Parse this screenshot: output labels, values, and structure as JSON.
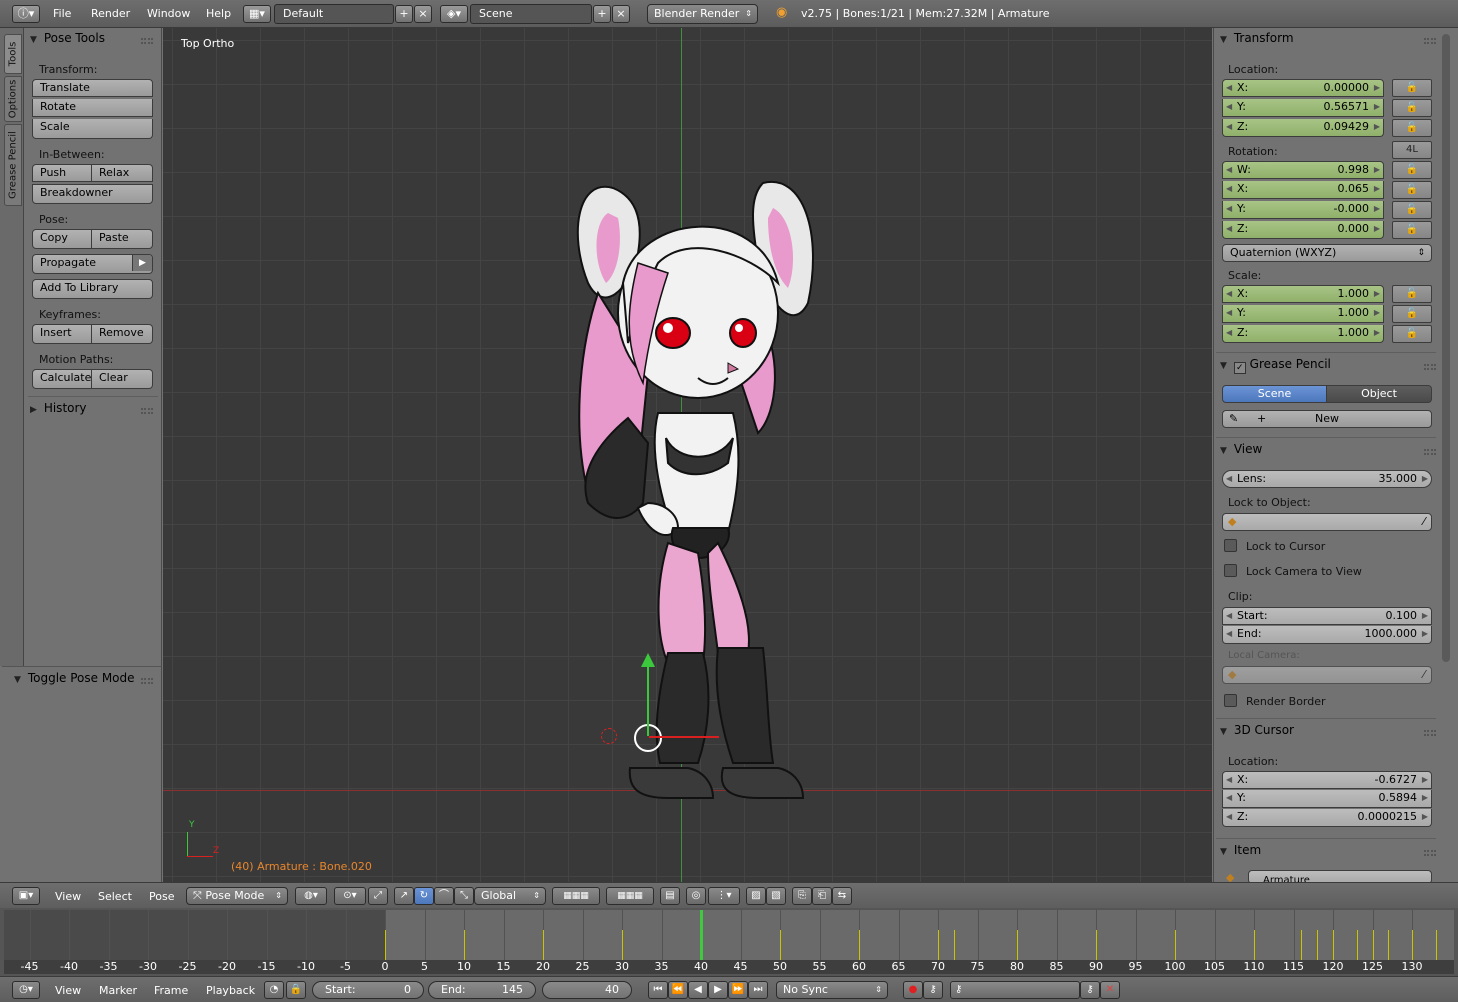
{
  "topbar": {
    "menus": [
      "File",
      "Render",
      "Window",
      "Help"
    ],
    "layout": "Default",
    "scene": "Scene",
    "engine": "Blender Render",
    "info": "v2.75 | Bones:1/21 | Mem:27.32M | Armature"
  },
  "left_tabs": [
    "Tools",
    "Options",
    "Grease Pencil"
  ],
  "tool_shelf": {
    "panel_title": "Pose Tools",
    "transform_label": "Transform:",
    "translate": "Translate",
    "rotate": "Rotate",
    "scale": "Scale",
    "inbetween_label": "In-Between:",
    "push": "Push",
    "relax": "Relax",
    "breakdowner": "Breakdowner",
    "pose_label": "Pose:",
    "copy": "Copy",
    "paste": "Paste",
    "propagate": "Propagate",
    "add_to_library": "Add To Library",
    "keyframes_label": "Keyframes:",
    "insert": "Insert",
    "remove": "Remove",
    "motion_paths_label": "Motion Paths:",
    "calculate": "Calculate",
    "clear": "Clear",
    "history": "History"
  },
  "operator_panel": {
    "title": "Toggle Pose Mode"
  },
  "viewport": {
    "view_name": "Top Ortho",
    "status": "(40) Armature : Bone.020",
    "axis_y_label": "Y",
    "axis_z_label": "Z"
  },
  "properties": {
    "transform_title": "Transform",
    "location_label": "Location:",
    "location": [
      {
        "axis": "X:",
        "value": "0.00000"
      },
      {
        "axis": "Y:",
        "value": "0.56571"
      },
      {
        "axis": "Z:",
        "value": "0.09429"
      }
    ],
    "rotation_label": "Rotation:",
    "rotation_lock_4l": "4L",
    "rotation": [
      {
        "axis": "W:",
        "value": "0.998"
      },
      {
        "axis": "X:",
        "value": "0.065"
      },
      {
        "axis": "Y:",
        "value": "-0.000"
      },
      {
        "axis": "Z:",
        "value": "0.000"
      }
    ],
    "rotation_mode": "Quaternion (WXYZ)",
    "scale_label": "Scale:",
    "scale": [
      {
        "axis": "X:",
        "value": "1.000"
      },
      {
        "axis": "Y:",
        "value": "1.000"
      },
      {
        "axis": "Z:",
        "value": "1.000"
      }
    ],
    "grease_pencil_title": "Grease Pencil",
    "gp_scene": "Scene",
    "gp_object": "Object",
    "gp_new": "New",
    "view_title": "View",
    "lens_label": "Lens:",
    "lens_value": "35.000",
    "lock_to_object_label": "Lock to Object:",
    "lock_to_cursor": "Lock to Cursor",
    "lock_camera_to_view": "Lock Camera to View",
    "clip_label": "Clip:",
    "clip_start_label": "Start:",
    "clip_start": "0.100",
    "clip_end_label": "End:",
    "clip_end": "1000.000",
    "local_camera_label": "Local Camera:",
    "render_border": "Render Border",
    "cursor_title": "3D Cursor",
    "cursor_location_label": "Location:",
    "cursor": [
      {
        "axis": "X:",
        "value": "-0.6727"
      },
      {
        "axis": "Y:",
        "value": "0.5894"
      },
      {
        "axis": "Z:",
        "value": "0.0000215"
      }
    ],
    "item_title": "Item",
    "item_name": "Armature"
  },
  "view_header": {
    "menus": [
      "View",
      "Select",
      "Pose"
    ],
    "mode": "Pose Mode",
    "orientation": "Global"
  },
  "timeline": {
    "ticks": [
      "-45",
      "-40",
      "-35",
      "-30",
      "-25",
      "-20",
      "-15",
      "-10",
      "-5",
      "0",
      "5",
      "10",
      "15",
      "20",
      "25",
      "30",
      "35",
      "40",
      "45",
      "50",
      "55",
      "60",
      "65",
      "70",
      "75",
      "80",
      "85",
      "90",
      "95",
      "100",
      "105",
      "110",
      "115",
      "120",
      "125",
      "130"
    ],
    "current_frame": 40,
    "keyframes": [
      0,
      10,
      20,
      30,
      40,
      50,
      60,
      70,
      72,
      80,
      90,
      100,
      110,
      116,
      118,
      120,
      123,
      125,
      127,
      130,
      133
    ]
  },
  "timeline_header": {
    "menus": [
      "View",
      "Marker",
      "Frame",
      "Playback"
    ],
    "start_label": "Start:",
    "start": "0",
    "end_label": "End:",
    "end": "145",
    "current": "40",
    "sync": "No Sync"
  },
  "colors": {
    "viewport_bg": "#393939",
    "keyframe": "#c8c400",
    "status_orange": "#e8862c",
    "field_green": "#9bbb77",
    "gp_scene_active": "#5680c2"
  }
}
